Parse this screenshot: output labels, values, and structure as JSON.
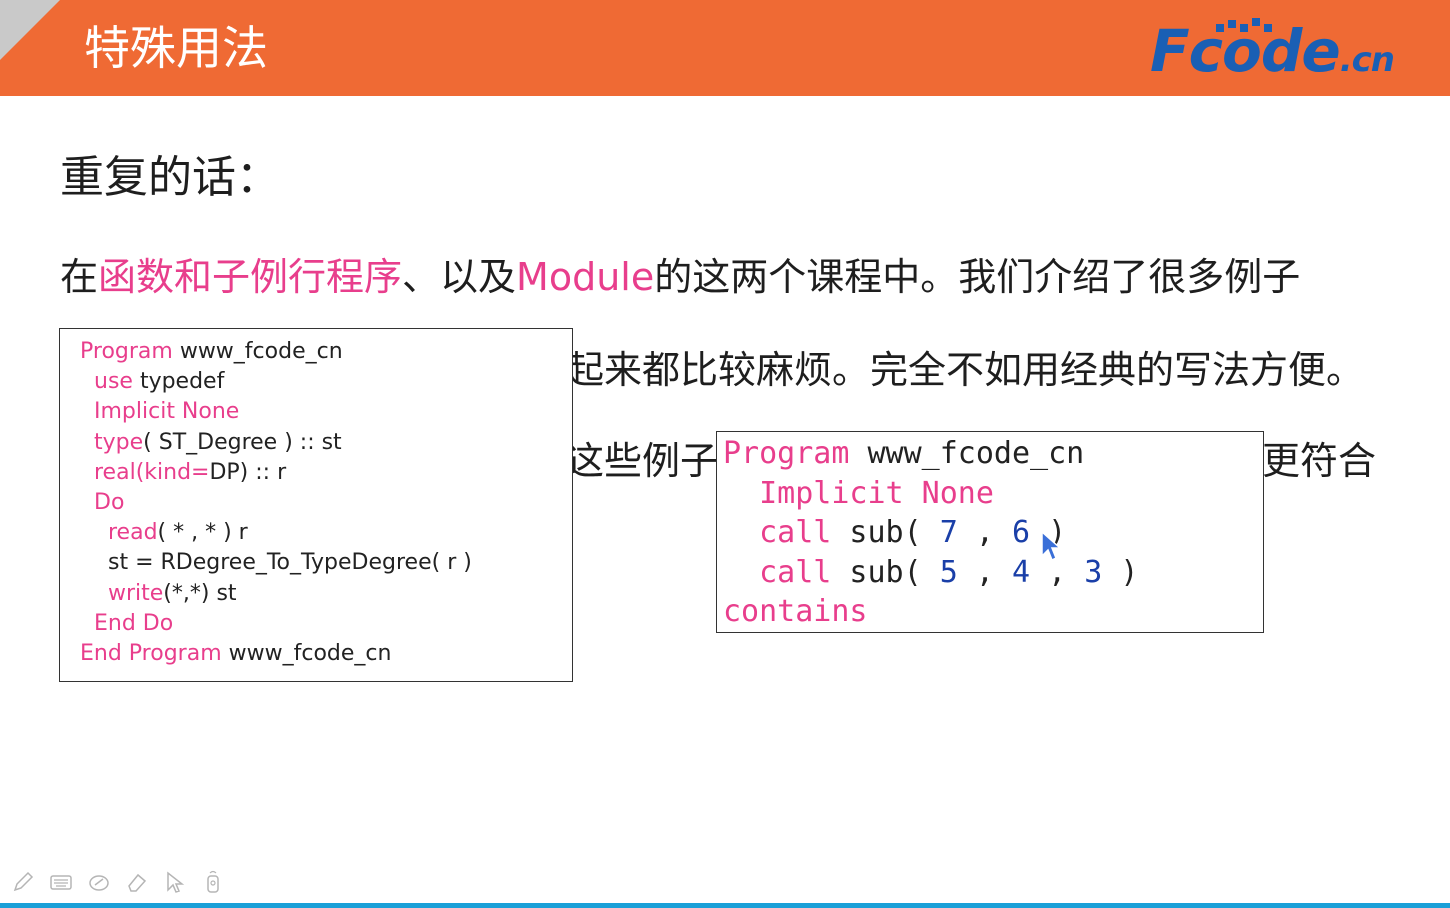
{
  "header": {
    "title": "特殊用法",
    "logo_main": "Fcode",
    "logo_suffix": ".cn",
    "colors": {
      "header_bg": "#ef6a34",
      "logo": "#1a5fb4"
    }
  },
  "heading": "重复的话：",
  "paragraphs": {
    "p1": {
      "a": "在",
      "b": "函数和子例行程序",
      "c": "、以及",
      "d": "Module",
      "e": "的这两个课程中。我们介绍了很多例子"
    },
    "p2_visible": "起来都比较麻烦。完全不如用经典的写法方便。",
    "p3_left": "这些例子的",
    "p3_right": "更符合"
  },
  "code1": {
    "lines": [
      {
        "kw": "Program",
        "rest": " www_fcode_cn"
      },
      {
        "indent": "  ",
        "kw": "use",
        "rest": " typedef"
      },
      {
        "indent": "  ",
        "kw": "Implicit None",
        "rest": ""
      },
      {
        "indent": "  ",
        "kw": "type",
        "rest": "( ST_Degree ) :: st"
      },
      {
        "indent": "  ",
        "kw": "real(kind=",
        "rest": "DP) :: r"
      },
      {
        "indent": "  ",
        "kw": "Do",
        "rest": ""
      },
      {
        "indent": "    ",
        "kw": "read",
        "rest": "( * , * ) r"
      },
      {
        "indent": "    ",
        "kw": "",
        "rest": "st = RDegree_To_TypeDegree( r )"
      },
      {
        "indent": "    ",
        "kw": "write",
        "rest": "(*,*) st"
      },
      {
        "indent": "  ",
        "kw": "End Do",
        "rest": ""
      },
      {
        "indent": "",
        "kw": "End Program",
        "rest": " www_fcode_cn"
      }
    ]
  },
  "code2": {
    "line1": {
      "kw": "Program",
      "rest": " www_fcode_cn"
    },
    "line2": {
      "kw": "Implicit None"
    },
    "line3": {
      "kw": "call",
      "p1": " sub( ",
      "n1": "7",
      "p2": " , ",
      "n2": "6",
      "p3": " )"
    },
    "line4": {
      "kw": "call",
      "p1": " sub( ",
      "n1": "5",
      "p2": " , ",
      "n2": "4",
      "p3": " , ",
      "n3": "3",
      "p4": " )"
    },
    "line5": {
      "kw": "contains"
    }
  },
  "toolbar": [
    "pen-icon",
    "keyboard-icon",
    "highlighter-icon",
    "eraser-icon",
    "pointer-icon",
    "laser-icon"
  ]
}
